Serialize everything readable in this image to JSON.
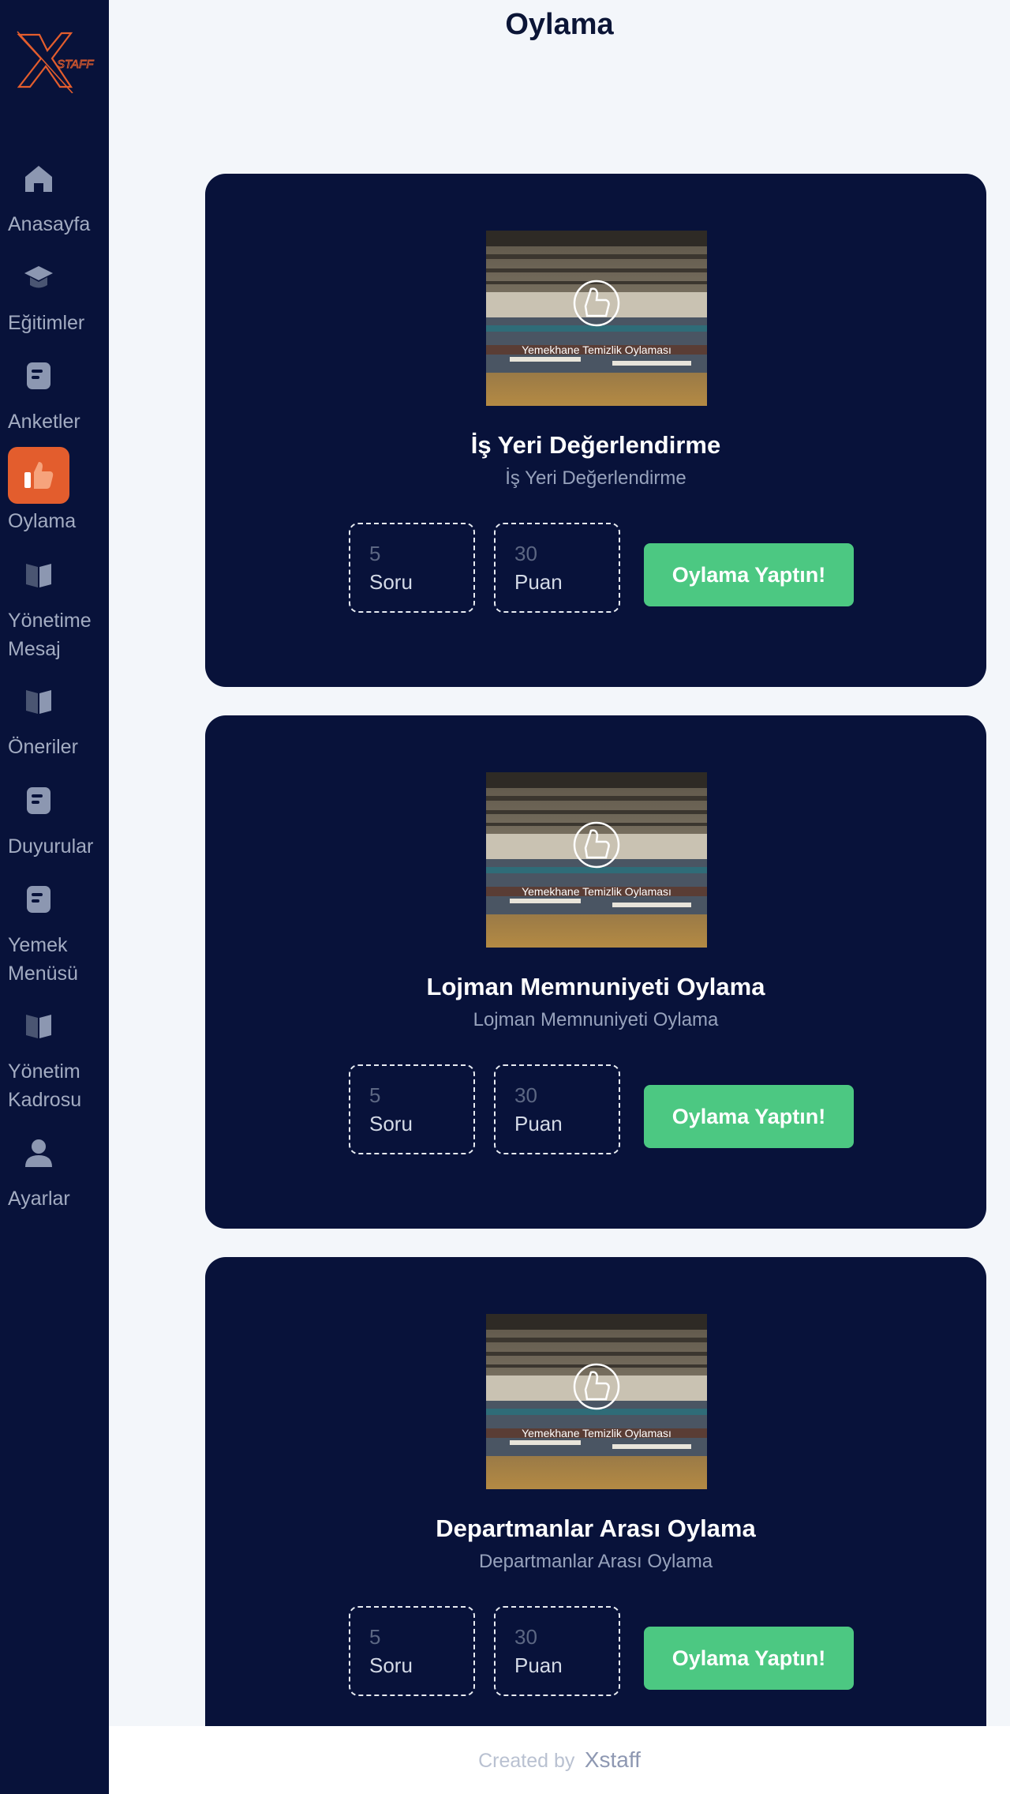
{
  "page": {
    "title": "Oylama"
  },
  "brand": {
    "logo_text": "STAFF",
    "accent_color": "#e35d2d"
  },
  "sidebar": {
    "items": [
      {
        "label": "Anasayfa",
        "icon": "home-icon"
      },
      {
        "label": "Eğitimler",
        "icon": "graduation-cap-icon"
      },
      {
        "label": "Anketler",
        "icon": "document-icon"
      },
      {
        "label": "Oylama",
        "icon": "thumbs-up-icon",
        "active": true
      },
      {
        "label": "Yönetime Mesaj",
        "label_line1": "Yönetime",
        "label_line2": "Mesaj",
        "icon": "book-icon"
      },
      {
        "label": "Öneriler",
        "icon": "book-icon"
      },
      {
        "label": "Duyurular",
        "icon": "document-icon"
      },
      {
        "label": "Yemek Menüsü",
        "label_line1": "Yemek",
        "label_line2": "Menüsü",
        "icon": "document-icon"
      },
      {
        "label": "Yönetim Kadrosu",
        "label_line1": "Yönetim",
        "label_line2": "Kadrosu",
        "icon": "book-icon"
      },
      {
        "label": "Ayarlar",
        "icon": "user-icon"
      }
    ]
  },
  "polls": [
    {
      "image_caption": "Yemekhane Temizlik Oylaması",
      "title": "İş Yeri Değerlendirme",
      "subtitle": "İş Yeri Değerlendirme",
      "questions": "5",
      "questions_label": "Soru",
      "points": "30",
      "points_label": "Puan",
      "button": "Oylama Yaptın!"
    },
    {
      "image_caption": "Yemekhane Temizlik Oylaması",
      "title": "Lojman Memnuniyeti Oylama",
      "subtitle": "Lojman Memnuniyeti Oylama",
      "questions": "5",
      "questions_label": "Soru",
      "points": "30",
      "points_label": "Puan",
      "button": "Oylama Yaptın!"
    },
    {
      "image_caption": "Yemekhane Temizlik Oylaması",
      "title": "Departmanlar Arası Oylama",
      "subtitle": "Departmanlar Arası Oylama",
      "questions": "5",
      "questions_label": "Soru",
      "points": "30",
      "points_label": "Puan",
      "button": "Oylama Yaptın!"
    }
  ],
  "footer": {
    "prefix": "Created by",
    "brand": "Xstaff"
  }
}
